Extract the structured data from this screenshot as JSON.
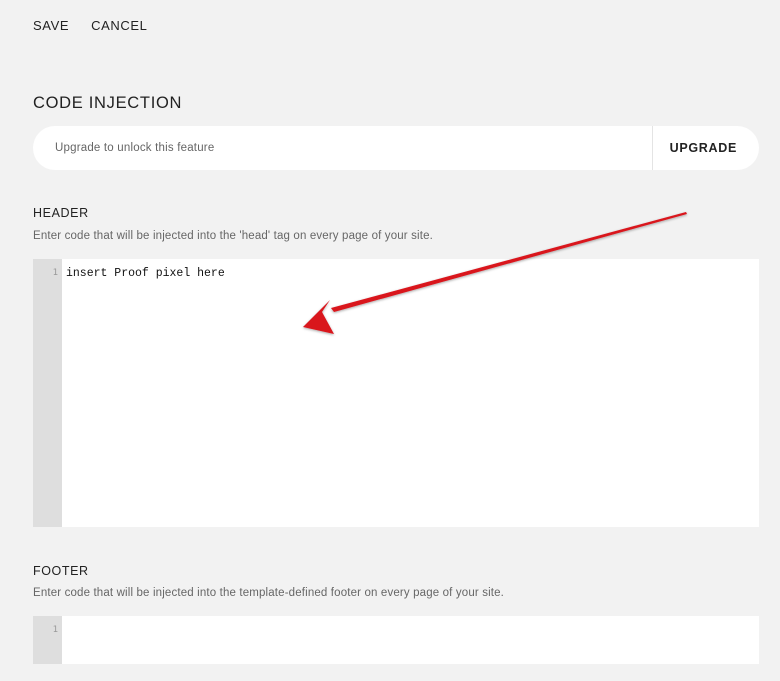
{
  "toolbar": {
    "save_label": "SAVE",
    "cancel_label": "CANCEL"
  },
  "code_injection": {
    "title": "CODE INJECTION",
    "upgrade_message": "Upgrade to unlock this feature",
    "upgrade_button_label": "UPGRADE"
  },
  "header_field": {
    "label": "HEADER",
    "description": "Enter code that will be injected into the 'head' tag on every page of your site.",
    "line_number": "1",
    "code": "insert Proof pixel here"
  },
  "footer_field": {
    "label": "FOOTER",
    "description": "Enter code that will be injected into the template-defined footer on every page of your site.",
    "line_number": "1",
    "code": ""
  },
  "annotation": {
    "arrow_color": "#d9141e"
  },
  "colors": {
    "background": "#f2f2f2",
    "editor_background": "#ffffff",
    "gutter_background": "#dedede"
  }
}
